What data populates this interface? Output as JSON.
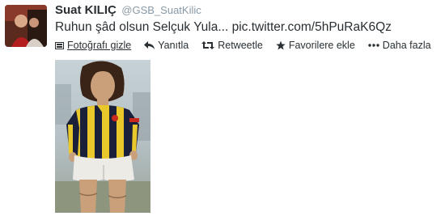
{
  "tweet": {
    "author_name": "Suat KILIÇ",
    "author_handle": "@GSB_SuatKilic",
    "text_start": "Ruhun şâd olsun Selçuk Yula... ",
    "text_link": "pic.twitter.com/5hPuRaK6Qz"
  },
  "actions": {
    "hide_photo": "Fotoğrafı gizle",
    "reply": "Yanıtla",
    "retweet": "Retweetle",
    "favorite": "Favorilere ekle",
    "more": "Daha fazla"
  },
  "icons": {
    "hide_photo": "photo-icon",
    "reply": "reply-arrow-icon",
    "retweet": "retweet-arrows-icon",
    "favorite": "star-icon",
    "more": "ellipsis-icon"
  },
  "colors": {
    "text": "#292f33",
    "handle": "#8899a6",
    "jersey_yellow": "#e8c82a",
    "jersey_navy": "#1a1f3a"
  }
}
